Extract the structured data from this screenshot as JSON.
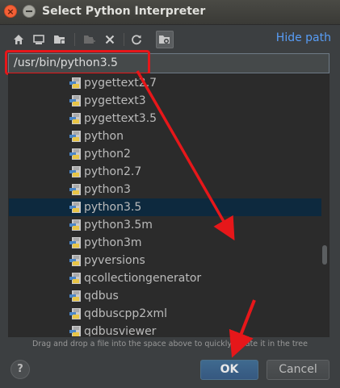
{
  "dialog": {
    "title": "Select Python Interpreter"
  },
  "toolbar": {
    "icons": [
      "home-icon",
      "desktop-icon",
      "project-folder-icon",
      "new-folder-icon",
      "delete-icon",
      "refresh-icon",
      "show-hidden-icon"
    ],
    "hide_path_label": "Hide path"
  },
  "path_field": {
    "value": "/usr/bin/python3.5"
  },
  "tree": {
    "items": [
      {
        "label": "pygettext2.7",
        "selected": false
      },
      {
        "label": "pygettext3",
        "selected": false
      },
      {
        "label": "pygettext3.5",
        "selected": false
      },
      {
        "label": "python",
        "selected": false
      },
      {
        "label": "python2",
        "selected": false
      },
      {
        "label": "python2.7",
        "selected": false
      },
      {
        "label": "python3",
        "selected": false
      },
      {
        "label": "python3.5",
        "selected": true
      },
      {
        "label": "python3.5m",
        "selected": false
      },
      {
        "label": "python3m",
        "selected": false
      },
      {
        "label": "pyversions",
        "selected": false
      },
      {
        "label": "qcollectiongenerator",
        "selected": false
      },
      {
        "label": "qdbus",
        "selected": false
      },
      {
        "label": "qdbuscpp2xml",
        "selected": false
      },
      {
        "label": "qdbusviewer",
        "selected": false
      }
    ]
  },
  "hint_text": "Drag and drop a file into the space above to quickly locate it in the tree",
  "buttons": {
    "help_label": "?",
    "ok_label": "OK",
    "cancel_label": "Cancel"
  },
  "colors": {
    "accent_link": "#589df6",
    "selection": "#0d293e",
    "annotation_red": "#e6171a"
  }
}
